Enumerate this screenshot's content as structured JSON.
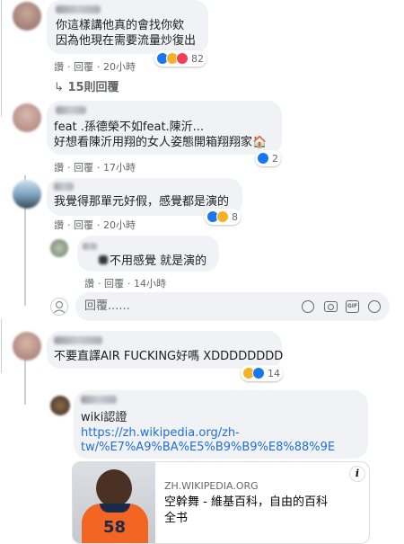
{
  "comments": [
    {
      "line1": "你這樣講他真的會找你欸",
      "line2": "因為他現在需要流量炒復出",
      "actions": {
        "like": "讚",
        "reply": "回覆",
        "time": "20小時"
      },
      "reaction_count": "82"
    },
    {
      "line1": "feat .孫德榮不如feat.陳沂...",
      "line2": "好想看陳沂用翔的女人姿態開箱翔翔家🏠",
      "actions": {
        "like": "讚",
        "reply": "回覆",
        "time": "17小時"
      },
      "reaction_count": "2"
    },
    {
      "line1": "我覺得那單元好假，感覺都是演的",
      "actions": {
        "like": "讚",
        "reply": "回覆",
        "time": "20小時"
      },
      "reaction_count": "8"
    }
  ],
  "replies_link": "15則回覆",
  "nested_reply": {
    "text": "不用感覺 就是演的",
    "actions": {
      "like": "讚",
      "reply": "回覆",
      "time": "14小時"
    }
  },
  "reply_input": {
    "placeholder": "回覆......"
  },
  "comment4": {
    "text": "不要直譯AIR FUCKING好嗎 XDDDDDDDD",
    "reaction_count": "14"
  },
  "comment5": {
    "line1": "wiki認證",
    "url_line1": "https://zh.wikipedia.org/zh-",
    "url_line2": "tw/%E7%A9%BA%E5%B9%B9%E8%88%9E"
  },
  "link_preview": {
    "domain": "ZH.WIKIPEDIA.ORG",
    "title_line1": "空幹舞 - 維基百科，自由的百科",
    "title_line2": "全书",
    "info": "i",
    "jersey_number": "58"
  }
}
